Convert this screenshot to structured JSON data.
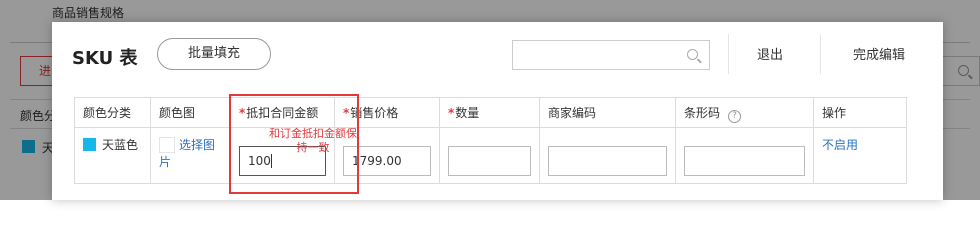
{
  "background": {
    "section_title": "商品销售规格",
    "batch_button_label": "进",
    "column_header": "颜色分",
    "row_value": "天"
  },
  "modal": {
    "title": "SKU 表",
    "batch_fill_label": "批量填充",
    "search": {
      "placeholder": "",
      "value": ""
    },
    "exit_label": "退出",
    "finish_label": "完成编辑"
  },
  "table": {
    "headers": {
      "color_category": "颜色分类",
      "color_image": "颜色图",
      "deduct_amount": "抵扣合同金额",
      "sale_price": "销售价格",
      "quantity": "数量",
      "merchant_code": "商家编码",
      "barcode": "条形码",
      "actions": "操作"
    },
    "rows": [
      {
        "color_name": "天蓝色",
        "color_swatch": "#16b7e9",
        "select_image_label": "选择图片",
        "deduct_amount_value": "100",
        "sale_price_value": "1799.00",
        "quantity_value": "",
        "merchant_code_value": "",
        "barcode_value": "",
        "disable_label": "不启用"
      }
    ]
  },
  "annotation": {
    "note": "和订金抵扣金额保持一致",
    "color": "#e4393c"
  },
  "colors": {
    "accent_red": "#e4393c",
    "link_blue": "#2a73c4",
    "swatch_sky_blue": "#16b7e9"
  }
}
